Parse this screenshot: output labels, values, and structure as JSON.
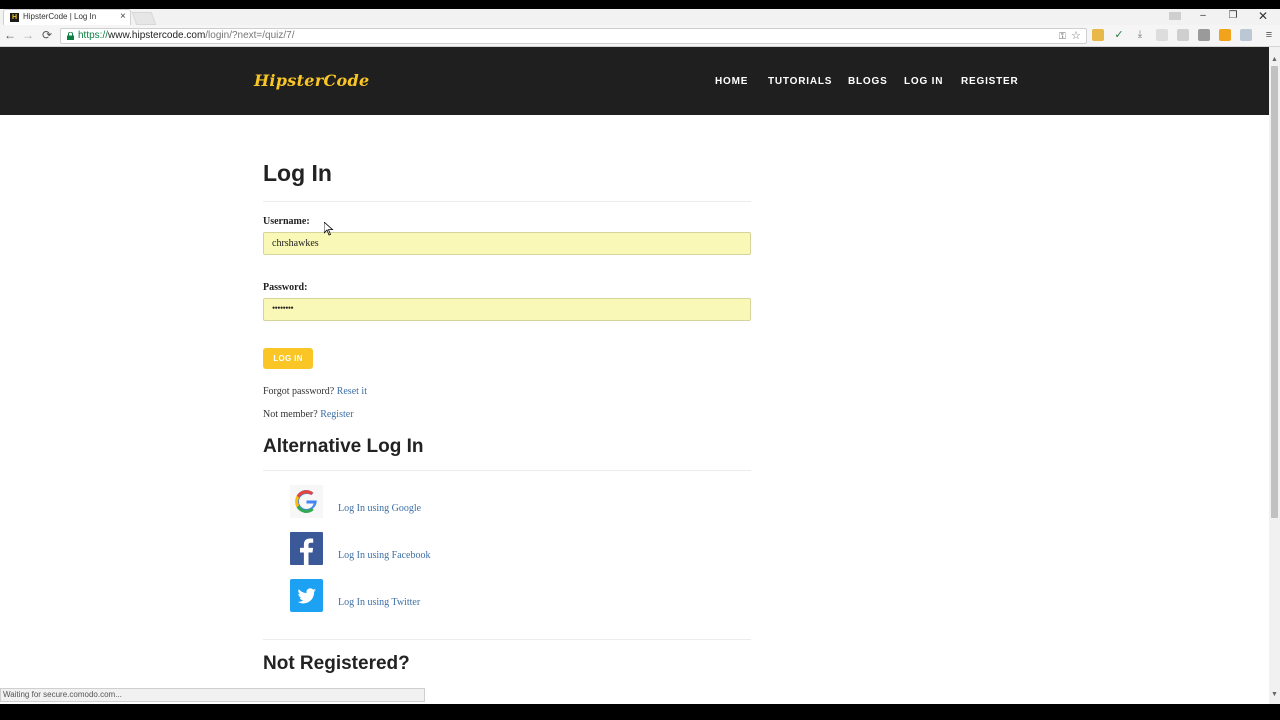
{
  "browser": {
    "tab_title": "HipsterCode | Log In",
    "tab_close": "×",
    "url_scheme": "https://",
    "url_host": "www.hipstercode.com",
    "url_path": "/login/?next=/quiz/7/",
    "status_text": "Waiting for secure.comodo.com..."
  },
  "site": {
    "logo": "HipsterCode",
    "nav": [
      "HOME",
      "TUTORIALS",
      "BLOGS",
      "LOG IN",
      "REGISTER"
    ]
  },
  "login": {
    "title": "Log In",
    "username_label": "Username:",
    "username_value": "chrshawkes",
    "password_label": "Password:",
    "password_value": "••••••••",
    "button": "LOG IN",
    "forgot_text": "Forgot password?",
    "forgot_link": "Reset it",
    "member_text": "Not member?",
    "member_link": "Register"
  },
  "alternative": {
    "title": "Alternative Log In",
    "google": "Log In using Google",
    "facebook": "Log In using Facebook",
    "twitter": "Log In using Twitter"
  },
  "not_registered": {
    "title": "Not Registered?"
  },
  "colors": {
    "accent": "#f9c626",
    "header_bg": "#1f1f1f",
    "autofill": "#faf8b6",
    "link": "#3d6fa5"
  }
}
